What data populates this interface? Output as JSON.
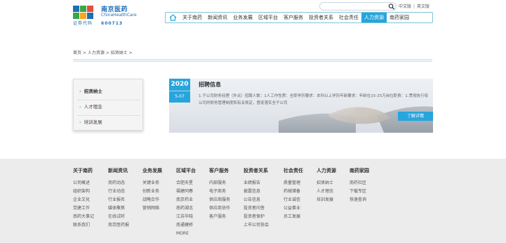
{
  "brand": {
    "name_cn": "南京医药",
    "name_en": "ChinaHealthCare",
    "stock_label": "证券代码",
    "stock_code": "600713",
    "colors": [
      "#1f6fb5",
      "#3aa648",
      "#e94b3c",
      "#f5a623"
    ]
  },
  "search": {
    "placeholder": "",
    "icon": "search-icon"
  },
  "lang": {
    "cn": "中文版",
    "en": "英文版"
  },
  "nav": {
    "home_icon": "home-icon",
    "items": [
      "关于南药",
      "新闻资讯",
      "业务发展",
      "区域平台",
      "客户服务",
      "投资者关系",
      "社会责任",
      "人力资源",
      "南药家园"
    ],
    "active_index": 7
  },
  "breadcrumb": "首页 > 人力资源 > 招贤纳士 >",
  "sidebar": {
    "items": [
      "招贤纳士",
      "人才理念",
      "培训发展"
    ],
    "current_index": 0
  },
  "job": {
    "year": "2020",
    "month_day": "5-07",
    "title": "招聘信息",
    "desc": "1.子公司财务经理（外派）招聘人数：1人工作性质：全职学历要求：本科以上学历年龄要求：年龄在15-25万岗位职责：1.贯彻执行母公司的财务管理制度和有关规定，督促落实全子公司",
    "more": "了解详情"
  },
  "footer": {
    "columns": [
      {
        "title": "关于南药",
        "links": [
          "公司概述",
          "组织架构",
          "企业文化",
          "党建工作",
          "南药大事记",
          "联系我们"
        ]
      },
      {
        "title": "新闻资讯",
        "links": [
          "南药动态",
          "行业动态",
          "行业报名",
          "媒体聚焦",
          "在线试听",
          "南京医药报"
        ]
      },
      {
        "title": "业务发展",
        "links": [
          "关键业务",
          "创新业务",
          "战略合作",
          "营销网络"
        ]
      },
      {
        "title": "区域平台",
        "links": [
          "合肥天星",
          "福建同春",
          "南京药业",
          "南药湖北",
          "江苏华晓",
          "南通健桥",
          "MORE"
        ]
      },
      {
        "title": "客户服务",
        "links": [
          "内部服务",
          "电子商务",
          "供应商服务",
          "供应商协作",
          "客户服务"
        ]
      },
      {
        "title": "投资者关系",
        "links": [
          "业绩报告",
          "披露信息",
          "公告信息",
          "投资者问答",
          "投资者保护",
          "上市公司协会"
        ]
      },
      {
        "title": "社会责任",
        "links": [
          "质量管理",
          "药械储备",
          "行业诚信",
          "公益事业",
          "员工发展"
        ]
      },
      {
        "title": "人力资源",
        "links": [
          "招贤纳士",
          "人才理念",
          "培训发展"
        ]
      },
      {
        "title": "南药家园",
        "links": [
          "南药社区",
          "下载专区",
          "快速查询"
        ]
      }
    ]
  }
}
